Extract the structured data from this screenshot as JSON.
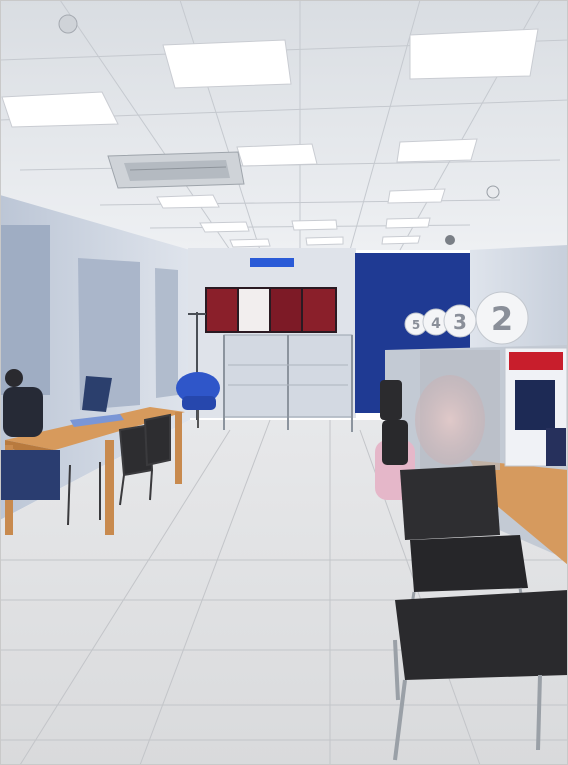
{
  "scene": {
    "counter_numbers": [
      "2",
      "3",
      "4",
      "5"
    ]
  },
  "colors": {
    "accent_blue": "#1f3a93",
    "sign_blue": "#2a5bd7",
    "poster_red": "#8a1f2a"
  }
}
